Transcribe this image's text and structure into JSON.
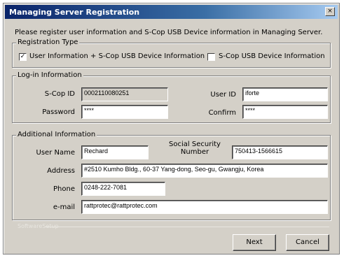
{
  "window": {
    "title": "Managing Server Registration",
    "close_glyph": "×"
  },
  "intro_text": "Please register user information and S-Cop USB Device information in Managing Server.",
  "registration_type": {
    "legend": "Registration Type",
    "option1_label": "User Information + S-Cop USB Device Information",
    "option1_checked": true,
    "option2_label": "S-Cop USB Device Information",
    "option2_checked": false,
    "check_glyph": "✓"
  },
  "login_info": {
    "legend": "Log-in Information",
    "scop_id_label": "S-Cop ID",
    "scop_id_value": "0002110080251",
    "user_id_label": "User ID",
    "user_id_value": "iforte",
    "password_label": "Password",
    "password_value": "****",
    "confirm_label": "Confirm",
    "confirm_value": "****"
  },
  "additional_info": {
    "legend": "Additional Information",
    "user_name_label": "User Name",
    "user_name_value": "Rechard",
    "ssn_label_line1": "Social Security",
    "ssn_label_line2": "Number",
    "ssn_value": "750413-1566615",
    "address_label": "Address",
    "address_value": "#2510 Kumho Bldg., 60-37 Yang-dong, Seo-gu, Gwangju, Korea",
    "phone_label": "Phone",
    "phone_value": "0248-222-7081",
    "email_label": "e-mail",
    "email_value": "rattprotec@rattprotec.com"
  },
  "footer_faint": "SoftwareSetup",
  "buttons": {
    "next": "Next",
    "cancel": "Cancel"
  }
}
